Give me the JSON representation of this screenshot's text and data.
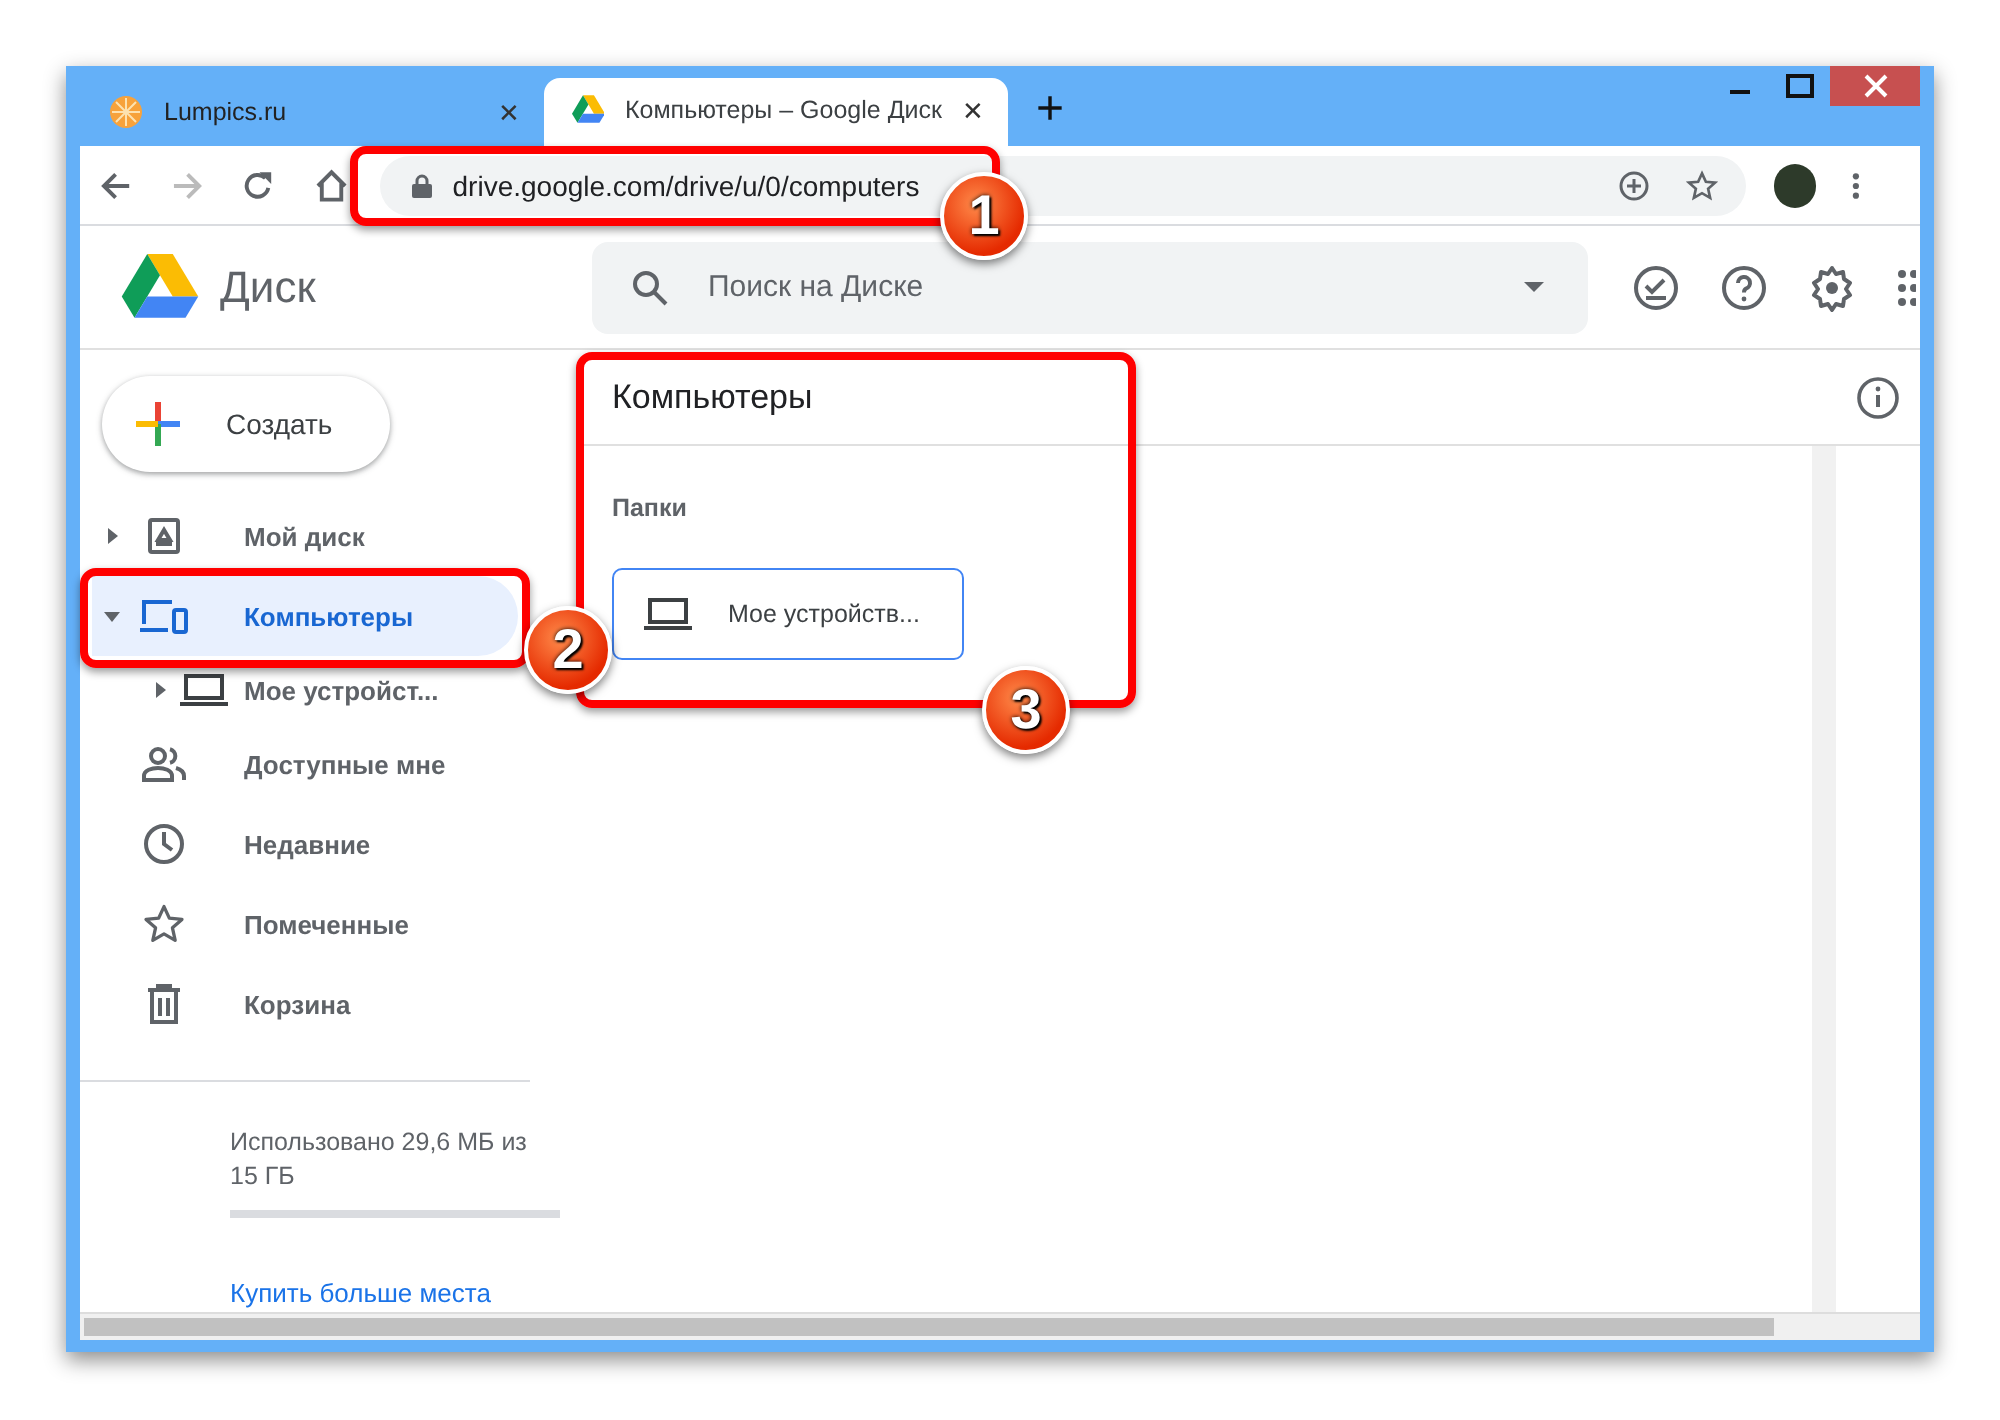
{
  "browser": {
    "tabs": [
      {
        "title": "Lumpics.ru",
        "selected": false,
        "kind": "site",
        "close": "✕"
      },
      {
        "title": "Компьютеры – Google Диск",
        "selected": true,
        "kind": "drive",
        "close": "✕"
      }
    ],
    "new_tab": "+",
    "address": "drive.google.com/drive/u/0/computers"
  },
  "app": {
    "name": "Диск",
    "search": {
      "placeholder": "Поиск на Диске"
    }
  },
  "sidebar": {
    "create": "Создать",
    "items": [
      {
        "label": "Мой диск",
        "selected": false,
        "expanded": false
      },
      {
        "label": "Компьютеры",
        "selected": true,
        "expanded": true,
        "children": [
          {
            "label": "Мое устройст...",
            "selected": false,
            "expanded": false
          }
        ]
      },
      {
        "label": "Доступные мне",
        "selected": false
      },
      {
        "label": "Недавние",
        "selected": false
      },
      {
        "label": "Помеченные",
        "selected": false
      },
      {
        "label": "Корзина",
        "selected": false
      }
    ],
    "storage": "Использовано 29,6 МБ из 15 ГБ",
    "buy_link": "Купить больше места"
  },
  "main": {
    "title": "Компьютеры",
    "section": "Папки",
    "folders": [
      {
        "name": "Мое устройств..."
      }
    ]
  },
  "annotations": [
    {
      "number": "1"
    },
    {
      "number": "2"
    },
    {
      "number": "3"
    }
  ]
}
